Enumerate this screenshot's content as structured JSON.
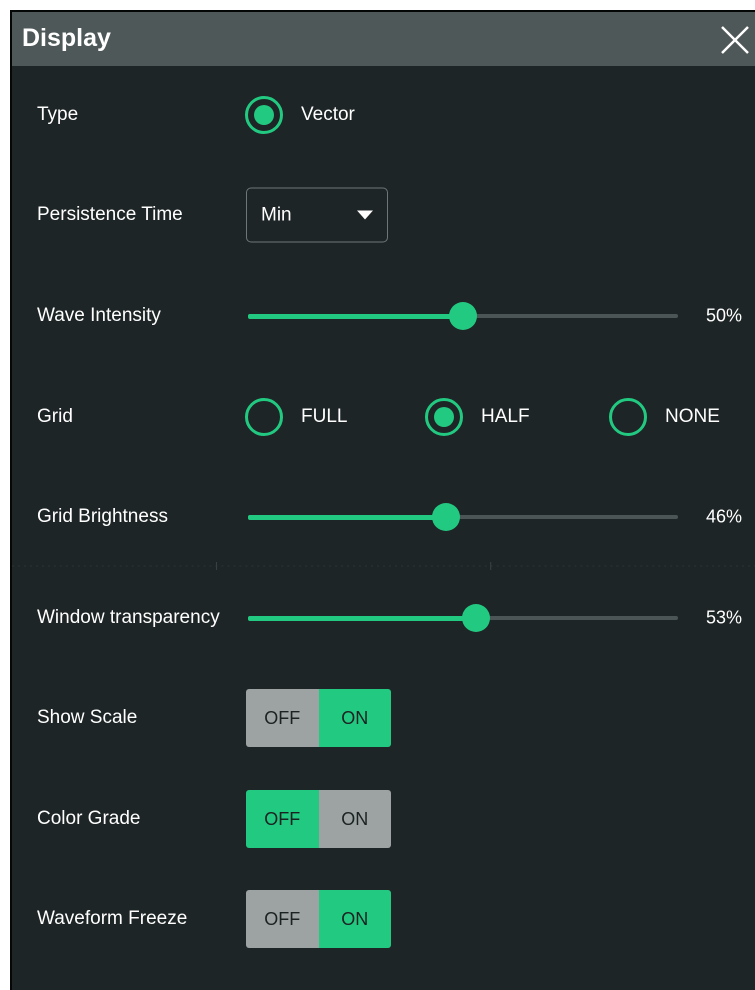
{
  "dialog": {
    "title": "Display",
    "close_icon": "close-icon"
  },
  "colors": {
    "accent": "#22c981",
    "panel_bg": "#1e2526",
    "titlebar_bg": "#4f5859",
    "toggle_off_bg": "#9da2a3"
  },
  "type": {
    "label": "Type",
    "options": [
      {
        "label": "Vector",
        "selected": true
      }
    ]
  },
  "persistence": {
    "label": "Persistence Time",
    "value": "Min",
    "icon": "caret-down-icon"
  },
  "wave_intensity": {
    "label": "Wave Intensity",
    "value": 50,
    "display": "50%"
  },
  "grid": {
    "label": "Grid",
    "options": [
      {
        "label": "FULL",
        "selected": false
      },
      {
        "label": "HALF",
        "selected": true
      },
      {
        "label": "NONE",
        "selected": false
      }
    ]
  },
  "grid_brightness": {
    "label": "Grid Brightness",
    "value": 46,
    "display": "46%"
  },
  "window_transparency": {
    "label": "Window transparency",
    "value": 53,
    "display": "53%"
  },
  "show_scale": {
    "label": "Show Scale",
    "off_label": "OFF",
    "on_label": "ON",
    "state": "ON"
  },
  "color_grade": {
    "label": "Color Grade",
    "off_label": "OFF",
    "on_label": "ON",
    "state": "OFF"
  },
  "waveform_freeze": {
    "label": "Waveform Freeze",
    "off_label": "OFF",
    "on_label": "ON",
    "state": "ON"
  }
}
